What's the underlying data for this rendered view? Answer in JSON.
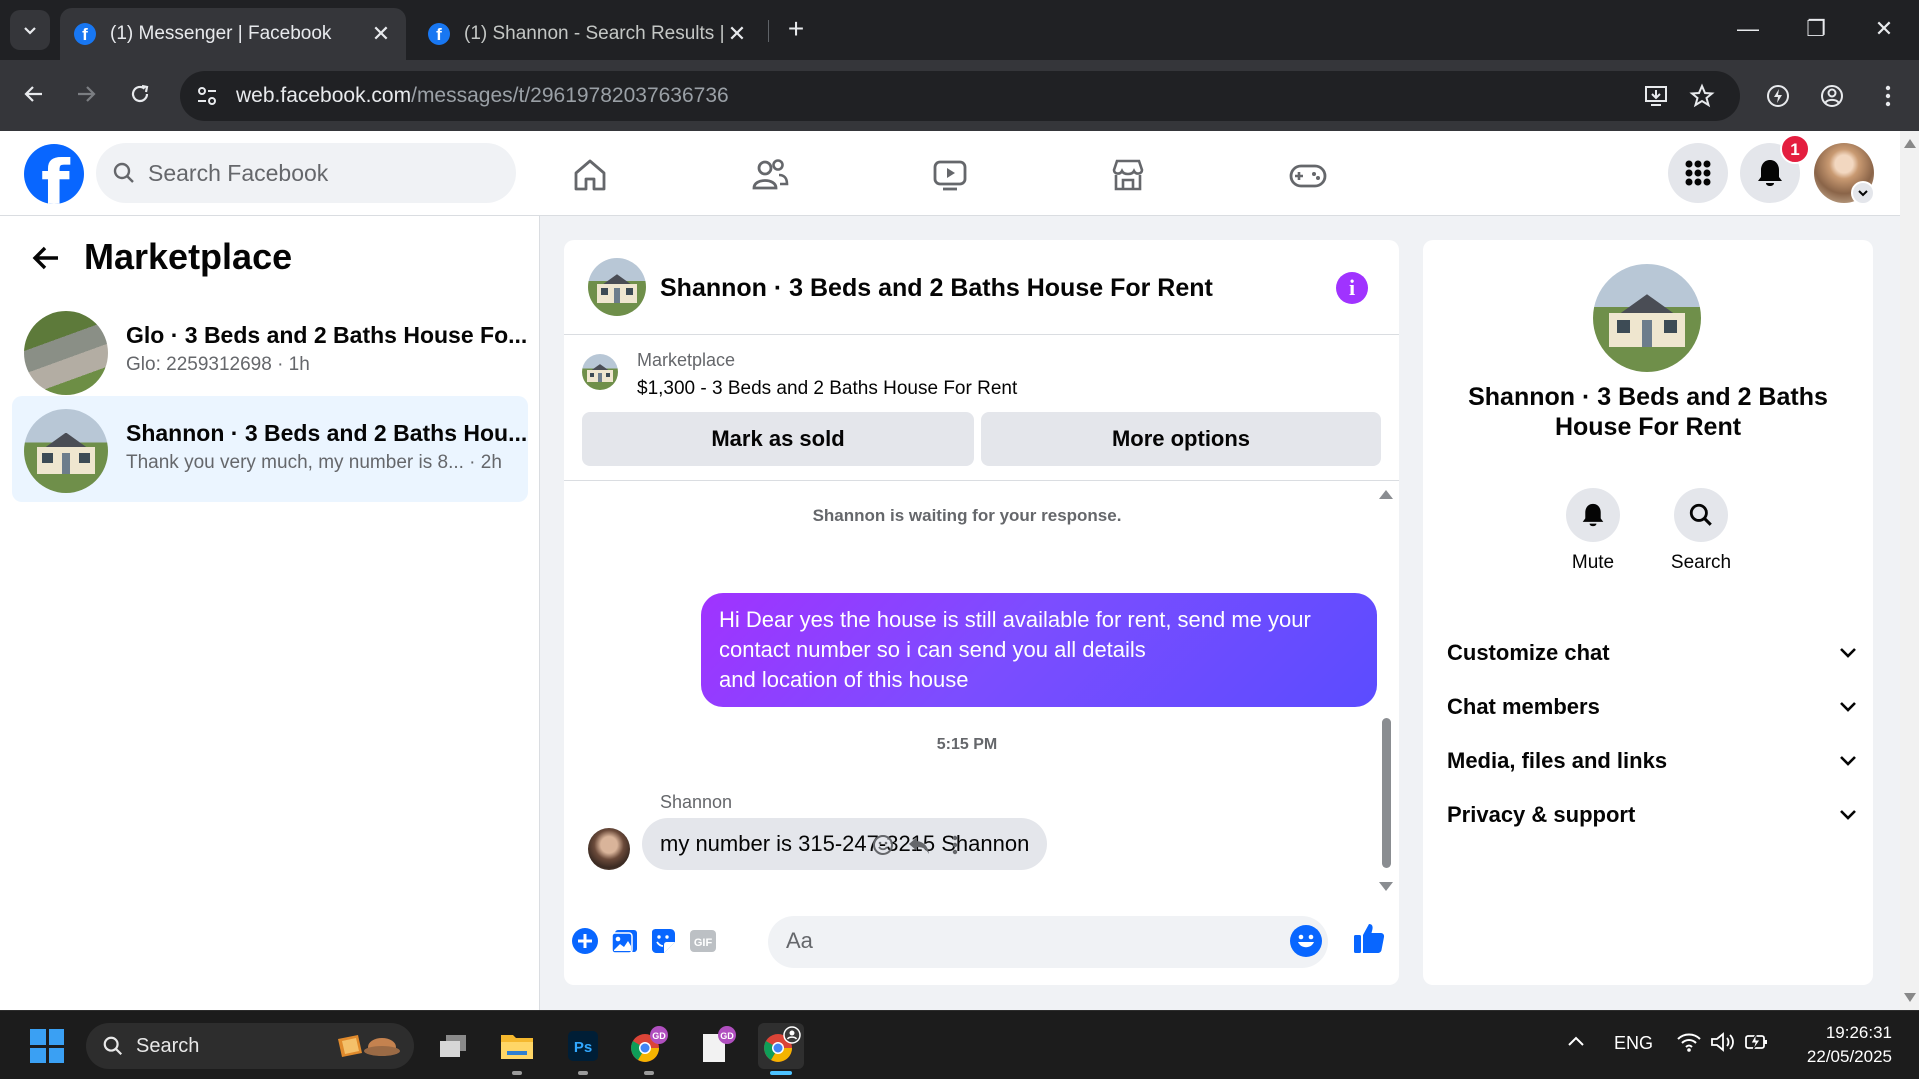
{
  "browser": {
    "tabs": [
      {
        "title": "(1) Messenger | Facebook",
        "active": true
      },
      {
        "title": "(1) Shannon - Search Results | F",
        "active": false
      }
    ],
    "url_domain": "web.facebook.com",
    "url_path": "/messages/t/29619782037636736"
  },
  "header": {
    "search_placeholder": "Search Facebook",
    "notification_count": "1"
  },
  "sidebar": {
    "title": "Marketplace",
    "conversations": [
      {
        "name": "Glo · 3 Beds and 2 Baths House Fo...",
        "preview": "Glo: 2259312698 · 1h",
        "selected": false
      },
      {
        "name": "Shannon · 3 Beds and 2 Baths Hou...",
        "preview": "Thank you very much, my number is 8... · 2h",
        "selected": true
      }
    ]
  },
  "chat": {
    "title": "Shannon · 3 Beds and 2 Baths House For Rent",
    "listing": {
      "label": "Marketplace",
      "price_title": "$1,300 - 3 Beds and 2 Baths House For Rent",
      "mark_sold": "Mark as sold",
      "more_options": "More options"
    },
    "waiting_notice": "Shannon is waiting for your response.",
    "messages": [
      {
        "direction": "out",
        "lines": [
          "Hi Dear yes the house is still available for rent, send me your",
          "contact number so i can send you all details",
          "and location of this house"
        ]
      },
      {
        "direction": "in",
        "sender": "Shannon",
        "text": "my number is 315-247-3215 Shannon"
      }
    ],
    "timestamp": "5:15 PM",
    "composer_placeholder": "Aa",
    "colors": {
      "accent": "#0866ff",
      "bubble_start": "#a033ff",
      "bubble_end": "#5b4cff",
      "info": "#a033ff"
    }
  },
  "details": {
    "name_line1": "Shannon · 3 Beds and 2 Baths",
    "name_line2": "House For Rent",
    "actions": [
      "Mute",
      "Search"
    ],
    "sections": [
      "Customize chat",
      "Chat members",
      "Media, files and links",
      "Privacy & support"
    ]
  },
  "taskbar": {
    "search_label": "Search",
    "language": "ENG",
    "time": "19:26:31",
    "date": "22/05/2025",
    "badge_gd": "GD",
    "apps": [
      "task-view",
      "file-explorer",
      "photoshop",
      "chrome-gd",
      "notes-gd",
      "chrome-active"
    ]
  }
}
